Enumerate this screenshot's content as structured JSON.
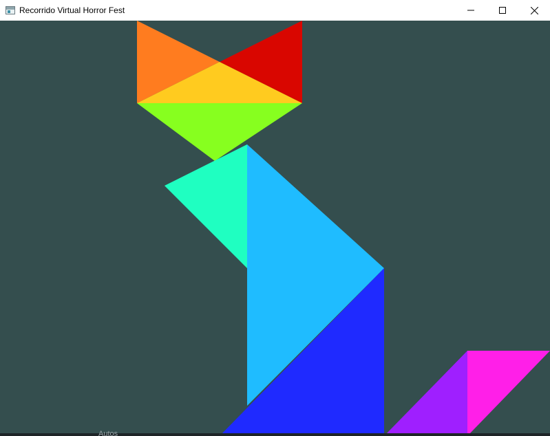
{
  "window": {
    "title": "Recorrido Virtual Horror Fest",
    "app_icon": "window-app-icon",
    "background_color": "#344e4e",
    "controls": [
      {
        "name": "minimize-button",
        "icon": "minimize-icon"
      },
      {
        "name": "maximize-button",
        "icon": "maximize-icon"
      },
      {
        "name": "close-button",
        "icon": "close-icon"
      }
    ]
  },
  "scene": {
    "pieces": [
      {
        "name": "head-left-ear-triangle",
        "color": "#ff7c1f"
      },
      {
        "name": "head-right-ear-triangle",
        "color": "#d90600"
      },
      {
        "name": "head-center-triangle",
        "color": "#ffcb1f"
      },
      {
        "name": "head-lower-triangle",
        "color": "#87ff1f"
      },
      {
        "name": "neck-triangle",
        "color": "#1fffc1"
      },
      {
        "name": "body-upper-triangle",
        "color": "#1fbcff"
      },
      {
        "name": "body-lower-triangle",
        "color": "#1f2aff"
      },
      {
        "name": "tail-left-triangle",
        "color": "#9f1fff"
      },
      {
        "name": "tail-right-triangle",
        "color": "#ff1fe8"
      }
    ]
  },
  "background_window": {
    "partial_text": "Autos"
  }
}
